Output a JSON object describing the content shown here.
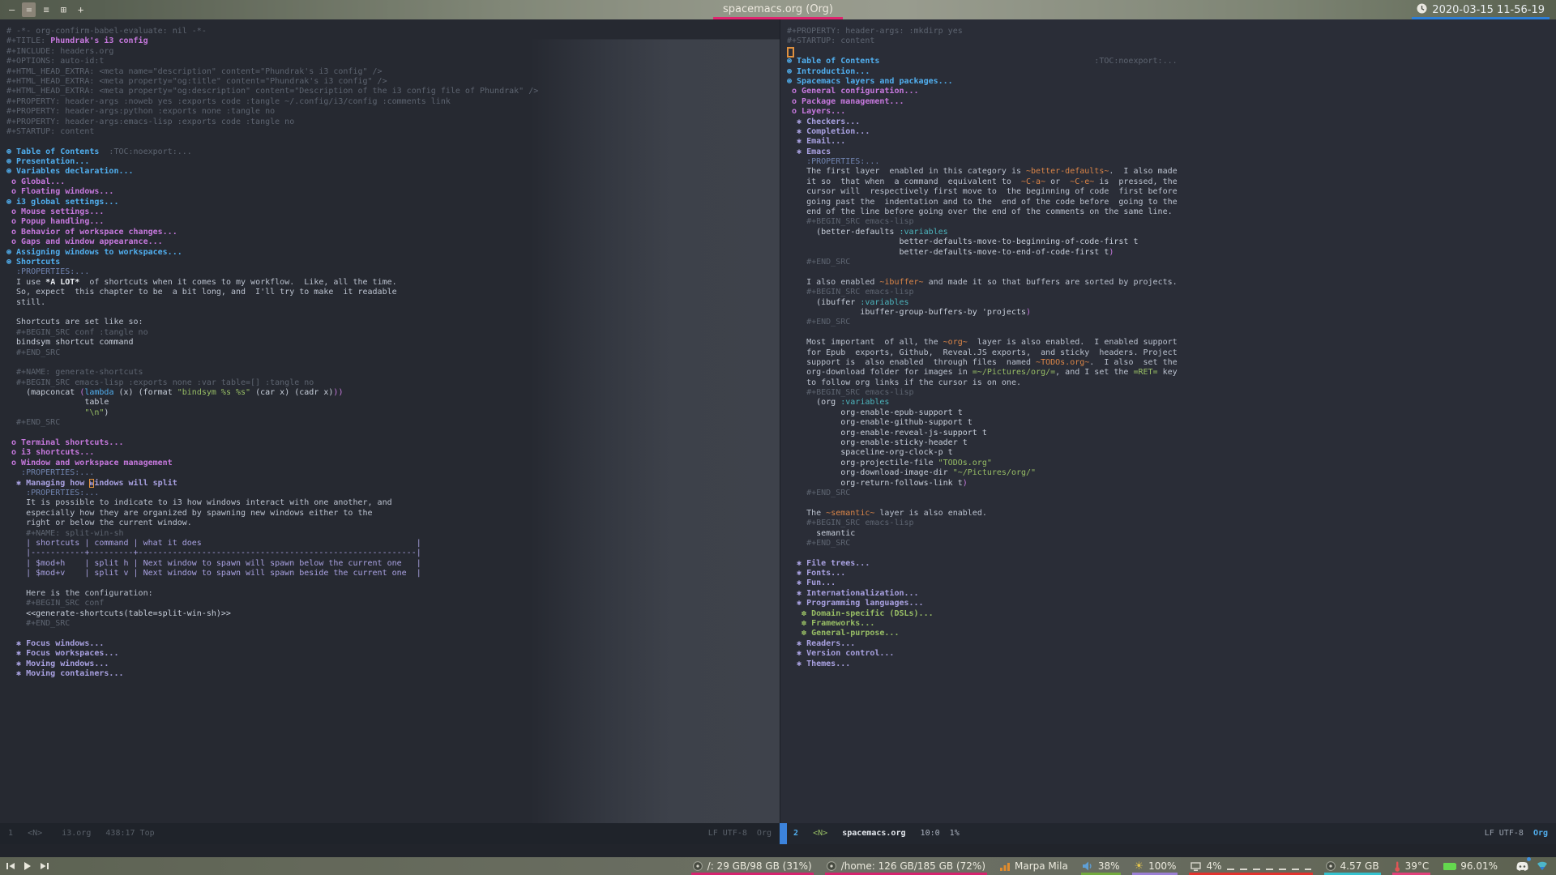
{
  "colors": {
    "accent_pink": "#d4246e",
    "accent_blue": "#2d7fd8",
    "org_level1": "#51afef",
    "org_level2": "#c678dd",
    "org_level3": "#a9a1e1",
    "org_level4": "#98be65",
    "inline_code_orange": "#da8548",
    "string_green": "#98be65",
    "cursor_orange": "#e0913f",
    "mode_line_accent": "#3c83dc"
  },
  "top_bar": {
    "left_icons": [
      {
        "name": "minimize-icon",
        "glyph": "—",
        "active": false
      },
      {
        "name": "layout-stacked-icon",
        "glyph": "=",
        "active": true
      },
      {
        "name": "layout-tabbed-icon",
        "glyph": "≡",
        "active": false
      },
      {
        "name": "windows-grid-icon",
        "glyph": "⊞",
        "active": false
      },
      {
        "name": "plus-icon",
        "glyph": "+",
        "active": false
      }
    ],
    "title": "spacemacs.org (Org)",
    "title_underline": "#e0256f",
    "clock": {
      "icon": "clock-icon",
      "label": "2020-03-15 11-56-19",
      "underline": "#2d7fd8"
    }
  },
  "editor": {
    "left_pane": {
      "lines": [
        [
          [
            "cm",
            "# -*- org-confirm-babel-evaluate: nil -*-"
          ]
        ],
        [
          [
            "cm",
            "#+TITLE: "
          ],
          [
            "tt",
            "Phundrak's i3 config"
          ]
        ],
        [
          [
            "cm",
            "#+INCLUDE: headers.org"
          ]
        ],
        [
          [
            "cm",
            "#+OPTIONS: auto-id:t"
          ]
        ],
        [
          [
            "cm",
            "#+HTML_HEAD_EXTRA: <meta name=\"description\" content=\"Phundrak's i3 config\" />"
          ]
        ],
        [
          [
            "cm",
            "#+HTML_HEAD_EXTRA: <meta property=\"og:title\" content=\"Phundrak's i3 config\" />"
          ]
        ],
        [
          [
            "cm",
            "#+HTML_HEAD_EXTRA: <meta property=\"og:description\" content=\"Description of the i3 config file of Phundrak\" />"
          ]
        ],
        [
          [
            "cm",
            "#+PROPERTY: header-args :noweb yes :exports code :tangle ~/.config/i3/config :comments link"
          ]
        ],
        [
          [
            "cm",
            "#+PROPERTY: header-args:python :exports none :tangle no"
          ]
        ],
        [
          [
            "cm",
            "#+PROPERTY: header-args:emacs-lisp :exports code :tangle no"
          ]
        ],
        [
          [
            "cm",
            "#+STARTUP: content"
          ]
        ],
        [],
        [
          [
            "h1",
            "⊛ Table of Contents"
          ],
          [
            "tg",
            "  :TOC:noexport:..."
          ]
        ],
        [
          [
            "h1",
            "⊛ Presentation..."
          ]
        ],
        [
          [
            "h1",
            "⊛ Variables declaration..."
          ]
        ],
        [
          [
            "h2",
            " o Global..."
          ]
        ],
        [
          [
            "h2",
            " o Floating windows..."
          ]
        ],
        [
          [
            "h1",
            "⊛ i3 global settings..."
          ]
        ],
        [
          [
            "h2",
            " o Mouse settings..."
          ]
        ],
        [
          [
            "h2",
            " o Popup handling..."
          ]
        ],
        [
          [
            "h2",
            " o Behavior of workspace changes..."
          ]
        ],
        [
          [
            "h2",
            " o Gaps and window appearance..."
          ]
        ],
        [
          [
            "h1",
            "⊛ Assigning windows to workspaces..."
          ]
        ],
        [
          [
            "h1",
            "⊛ Shortcuts"
          ]
        ],
        [
          [
            "dr",
            "  :PROPERTIES:..."
          ]
        ],
        [
          [
            "b",
            "  I use "
          ],
          [
            "wb",
            "*A LOT*"
          ],
          [
            "b",
            "  of shortcuts when it comes to my workflow.  Like, all the time."
          ]
        ],
        [
          [
            "b",
            "  So, expect  this chapter to be  a bit long, and  I'll try to make  it readable"
          ]
        ],
        [
          [
            "b",
            "  still."
          ]
        ],
        [],
        [
          [
            "b",
            "  Shortcuts are set like so:"
          ]
        ],
        [
          [
            "cm",
            "  #+BEGIN_SRC conf :tangle no"
          ]
        ],
        [
          [
            "cd",
            "  bindsym shortcut command"
          ]
        ],
        [
          [
            "cm",
            "  #+END_SRC"
          ]
        ],
        [],
        [
          [
            "cm",
            "  #+NAME: generate-shortcuts"
          ]
        ],
        [
          [
            "cm",
            "  #+BEGIN_SRC emacs-lisp :exports none :var table=[] :tangle no"
          ]
        ],
        [
          [
            "cd",
            "    (mapconcat "
          ],
          [
            "pp",
            "("
          ],
          [
            "fn",
            "lambda"
          ],
          [
            "cd",
            " (x) (format "
          ],
          [
            "st",
            "\"bindsym %s %s\""
          ],
          [
            "cd",
            " (car x) (cadr x)"
          ],
          [
            "pp",
            "))"
          ]
        ],
        [
          [
            "cd",
            "                table"
          ]
        ],
        [
          [
            "cd",
            "                "
          ],
          [
            "st",
            "\"\\n\""
          ],
          [
            "cd",
            ")"
          ]
        ],
        [
          [
            "cm",
            "  #+END_SRC"
          ]
        ],
        [],
        [
          [
            "h2",
            " o Terminal shortcuts..."
          ]
        ],
        [
          [
            "h2",
            " o i3 shortcuts..."
          ]
        ],
        [
          [
            "h2",
            " o Window and workspace management"
          ]
        ],
        [
          [
            "dr",
            "   :PROPERTIES:..."
          ]
        ],
        [
          [
            "h3",
            "  ✱ Managing how "
          ],
          [
            "h3 cuo",
            "w"
          ],
          [
            "h3",
            "indows will split"
          ]
        ],
        [
          [
            "dr",
            "    :PROPERTIES:..."
          ]
        ],
        [
          [
            "b",
            "    It is possible to indicate to i3 how windows interact with one another, and"
          ]
        ],
        [
          [
            "b",
            "    especially how they are organized by spawning new windows either to the"
          ]
        ],
        [
          [
            "b",
            "    right or below the current window."
          ]
        ],
        [
          [
            "cm",
            "    #+NAME: split-win-sh"
          ]
        ],
        [
          [
            "tbl",
            "    | shortcuts | command | what it does                                            |"
          ]
        ],
        [
          [
            "tbl",
            "    |-----------+---------+---------------------------------------------------------|"
          ]
        ],
        [
          [
            "tbl",
            "    | $mod+h    | split h | Next window to spawn will spawn below the current one   |"
          ]
        ],
        [
          [
            "tbl",
            "    | $mod+v    | split v | Next window to spawn will spawn beside the current one  |"
          ]
        ],
        [],
        [
          [
            "b",
            "    Here is the configuration:"
          ]
        ],
        [
          [
            "cm",
            "    #+BEGIN_SRC conf"
          ]
        ],
        [
          [
            "cd",
            "    <<generate-shortcuts(table=split-win-sh)>>"
          ]
        ],
        [
          [
            "cm",
            "    #+END_SRC"
          ]
        ],
        [],
        [
          [
            "h3",
            "  ✱ Focus windows..."
          ]
        ],
        [
          [
            "h3",
            "  ✱ Focus workspaces..."
          ]
        ],
        [
          [
            "h3",
            "  ✱ Moving windows..."
          ]
        ],
        [
          [
            "h3",
            "  ✱ Moving containers..."
          ]
        ]
      ]
    },
    "right_pane": {
      "lines": [
        [
          [
            "cm",
            "#+PROPERTY: header-args: :mkdirp yes"
          ]
        ],
        [
          [
            "cm",
            "#+STARTUP: content"
          ]
        ],
        [
          [
            "cub",
            ""
          ]
        ],
        [
          [
            "h1",
            "⊛ Table of Contents"
          ],
          [
            "tg",
            "                                            :TOC:noexport:..."
          ]
        ],
        [
          [
            "h1",
            "⊛ Introduction..."
          ]
        ],
        [
          [
            "h1",
            "⊛ Spacemacs layers and packages..."
          ]
        ],
        [
          [
            "h2",
            " o General configuration..."
          ]
        ],
        [
          [
            "h2",
            " o Package management..."
          ]
        ],
        [
          [
            "h2",
            " o Layers..."
          ]
        ],
        [
          [
            "h3",
            "  ✱ Checkers..."
          ]
        ],
        [
          [
            "h3",
            "  ✱ Completion..."
          ]
        ],
        [
          [
            "h3",
            "  ✱ Email..."
          ]
        ],
        [
          [
            "h3",
            "  ✱ Emacs"
          ]
        ],
        [
          [
            "dr",
            "    :PROPERTIES:..."
          ]
        ],
        [
          [
            "b",
            "    The first layer  enabled in this category is "
          ],
          [
            "co",
            "~better-defaults~"
          ],
          [
            "b",
            ".  I also made"
          ]
        ],
        [
          [
            "b",
            "    it so  that when  a command  equivalent to  "
          ],
          [
            "co",
            "~C-a~"
          ],
          [
            "b",
            " or  "
          ],
          [
            "co",
            "~C-e~"
          ],
          [
            "b",
            " is  pressed, the"
          ]
        ],
        [
          [
            "b",
            "    cursor will  respectively first move to  the beginning of code  first before"
          ]
        ],
        [
          [
            "b",
            "    going past the  indentation and to the  end of the code before  going to the"
          ]
        ],
        [
          [
            "b",
            "    end of the line before going over the end of the comments on the same line."
          ]
        ],
        [
          [
            "cm",
            "    #+BEGIN_SRC emacs-lisp"
          ]
        ],
        [
          [
            "cd",
            "      (better-defaults "
          ],
          [
            "cy",
            ":variables"
          ]
        ],
        [
          [
            "cd",
            "                       better-defaults-move-to-beginning-of-code-first t"
          ]
        ],
        [
          [
            "cd",
            "                       better-defaults-move-to-end-of-code-first t"
          ],
          [
            "pp",
            ")"
          ]
        ],
        [
          [
            "cm",
            "    #+END_SRC"
          ]
        ],
        [],
        [
          [
            "b",
            "    I also enabled "
          ],
          [
            "co",
            "~ibuffer~"
          ],
          [
            "b",
            " and made it so that buffers are sorted by projects."
          ]
        ],
        [
          [
            "cm",
            "    #+BEGIN_SRC emacs-lisp"
          ]
        ],
        [
          [
            "cd",
            "      (ibuffer "
          ],
          [
            "cy",
            ":variables"
          ]
        ],
        [
          [
            "cd",
            "               ibuffer-group-buffers-by 'projects"
          ],
          [
            "pp",
            ")"
          ]
        ],
        [
          [
            "cm",
            "    #+END_SRC"
          ]
        ],
        [],
        [
          [
            "b",
            "    Most important  of all, the "
          ],
          [
            "co",
            "~org~"
          ],
          [
            "b",
            "  layer is also enabled.  I enabled support"
          ]
        ],
        [
          [
            "b",
            "    for Epub  exports, Github,  Reveal.JS exports,  and sticky  headers. Project"
          ]
        ],
        [
          [
            "b",
            "    support is  also enabled  through files  named "
          ],
          [
            "co",
            "~TODOs.org~"
          ],
          [
            "b",
            ".  I also  set the"
          ]
        ],
        [
          [
            "b",
            "    org-download folder for images in "
          ],
          [
            "vb",
            "=~/Pictures/org/="
          ],
          [
            "b",
            ", and I set the "
          ],
          [
            "vb",
            "=RET="
          ],
          [
            "b",
            " key"
          ]
        ],
        [
          [
            "b",
            "    to follow org links if the cursor is on one."
          ]
        ],
        [
          [
            "cm",
            "    #+BEGIN_SRC emacs-lisp"
          ]
        ],
        [
          [
            "cd",
            "      (org "
          ],
          [
            "cy",
            ":variables"
          ]
        ],
        [
          [
            "cd",
            "           org-enable-epub-support t"
          ]
        ],
        [
          [
            "cd",
            "           org-enable-github-support t"
          ]
        ],
        [
          [
            "cd",
            "           org-enable-reveal-js-support t"
          ]
        ],
        [
          [
            "cd",
            "           org-enable-sticky-header t"
          ]
        ],
        [
          [
            "cd",
            "           spaceline-org-clock-p t"
          ]
        ],
        [
          [
            "cd",
            "           org-projectile-file "
          ],
          [
            "st",
            "\"TODOs.org\""
          ]
        ],
        [
          [
            "cd",
            "           org-download-image-dir "
          ],
          [
            "st",
            "\"~/Pictures/org/\""
          ]
        ],
        [
          [
            "cd",
            "           org-return-follows-link t"
          ],
          [
            "pp",
            ")"
          ]
        ],
        [
          [
            "cm",
            "    #+END_SRC"
          ]
        ],
        [],
        [
          [
            "b",
            "    The "
          ],
          [
            "co",
            "~semantic~"
          ],
          [
            "b",
            " layer is also enabled."
          ]
        ],
        [
          [
            "cm",
            "    #+BEGIN_SRC emacs-lisp"
          ]
        ],
        [
          [
            "cd",
            "      semantic"
          ]
        ],
        [
          [
            "cm",
            "    #+END_SRC"
          ]
        ],
        [],
        [
          [
            "h3",
            "  ✱ File trees..."
          ]
        ],
        [
          [
            "h3",
            "  ✱ Fonts..."
          ]
        ],
        [
          [
            "h3",
            "  ✱ Fun..."
          ]
        ],
        [
          [
            "h3",
            "  ✱ Internationalization..."
          ]
        ],
        [
          [
            "h3",
            "  ✱ Programming languages..."
          ]
        ],
        [
          [
            "h4",
            "   ✽ Domain-specific (DSLs)..."
          ]
        ],
        [
          [
            "h4",
            "   ✽ Frameworks..."
          ]
        ],
        [
          [
            "h4",
            "   ✽ General-purpose..."
          ]
        ],
        [
          [
            "h3",
            "  ✱ Readers..."
          ]
        ],
        [
          [
            "h3",
            "  ✱ Version control..."
          ]
        ],
        [
          [
            "h3",
            "  ✱ Themes..."
          ]
        ]
      ]
    },
    "left_mode_line": {
      "left": [
        [
          "mld",
          "1   <N>    i3.org   438:17 Top"
        ]
      ],
      "right": [
        [
          "mld",
          "LF UTF-8  Org"
        ]
      ]
    },
    "right_mode_line": {
      "left": [
        [
          "mlnum",
          "2"
        ],
        [
          "mls",
          "   "
        ],
        [
          "mlstate",
          "<N>"
        ],
        [
          "mls",
          "   "
        ],
        [
          "mlbuf",
          "spacemacs.org"
        ],
        [
          "mls",
          "   10:0  1%"
        ]
      ],
      "right": [
        [
          "mlr",
          "LF UTF-8  "
        ],
        [
          "mlmode",
          "Org"
        ]
      ]
    }
  },
  "bottom_bar": {
    "media": [
      {
        "name": "previous-icon"
      },
      {
        "name": "play-icon"
      },
      {
        "name": "next-icon"
      }
    ],
    "segments": [
      {
        "icon": "disk-icon",
        "text": "/: 29 GB/98 GB (31%)",
        "underline": "#d4246e",
        "graph": false
      },
      {
        "icon": "disk-icon",
        "text": "/home: 126 GB/185 GB (72%)",
        "underline": "#d4246e",
        "graph": false
      },
      {
        "icon": "network-icon",
        "text": "Marpa Mila",
        "underline": null,
        "graph": false
      },
      {
        "icon": "volume-icon",
        "text": "38%",
        "underline": "#72a93e",
        "graph": false
      },
      {
        "icon": "brightness-icon",
        "text": "100%",
        "underline": "#9b7fd4",
        "graph": false
      },
      {
        "icon": "cpu-icon",
        "text": "4%",
        "underline": "#e0332e",
        "graph": true
      },
      {
        "icon": "memory-icon",
        "text": "4.57 GB",
        "underline": "#35c1ce",
        "graph": false
      },
      {
        "icon": "temperature-icon",
        "text": "39°C",
        "underline": "#e0417a",
        "graph": false
      },
      {
        "icon": "battery-icon",
        "text": "96.01%",
        "underline": null,
        "graph": false
      }
    ],
    "tray": [
      {
        "name": "discord-tray-icon"
      },
      {
        "name": "wifi-tray-icon"
      }
    ]
  }
}
